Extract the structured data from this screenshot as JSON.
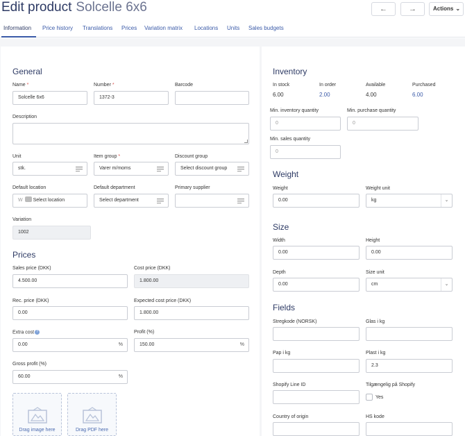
{
  "header": {
    "title": "Edit product",
    "product_name": "Solcelle 6x6",
    "prev_label": "←",
    "next_label": "→",
    "actions_label": "Actions"
  },
  "tabs": [
    {
      "label": "Information"
    },
    {
      "label": "Price history"
    },
    {
      "label": "Translations"
    },
    {
      "label": "Prices"
    },
    {
      "label": "Variation matrix"
    },
    {
      "label": "Locations"
    },
    {
      "label": "Units"
    },
    {
      "label": "Sales budgets"
    }
  ],
  "general": {
    "title": "General",
    "name": {
      "label": "Name",
      "required": "*",
      "value": "Solcelle 6x6"
    },
    "number": {
      "label": "Number",
      "required": "*",
      "value": "1372-3"
    },
    "barcode": {
      "label": "Barcode",
      "value": ""
    },
    "description": {
      "label": "Description",
      "value": ""
    },
    "unit": {
      "label": "Unit",
      "value": "stk."
    },
    "item_group": {
      "label": "Item group",
      "required": "*",
      "value": "Varer m/moms"
    },
    "discount_group": {
      "label": "Discount group",
      "value": "Select discount group"
    },
    "default_location": {
      "label": "Default location",
      "prefix": "W",
      "value": "Select location"
    },
    "default_department": {
      "label": "Default department",
      "value": "Select department"
    },
    "primary_supplier": {
      "label": "Primary supplier",
      "value": ""
    },
    "variation": {
      "label": "Variation",
      "value": "1002"
    }
  },
  "prices": {
    "title": "Prices",
    "sales_price": {
      "label": "Sales price (DKK)",
      "value": "4.500.00"
    },
    "cost_price": {
      "label": "Cost price (DKK)",
      "value": "1.800.00"
    },
    "rec_price": {
      "label": "Rec. price (DKK)",
      "value": "0.00"
    },
    "expected_cost": {
      "label": "Expected cost price (DKK)",
      "value": "1.800.00"
    },
    "extra_cost": {
      "label": "Extra cost",
      "value": "0.00",
      "suffix": "%"
    },
    "profit": {
      "label": "Profit (%)",
      "value": "150.00",
      "suffix": "%"
    },
    "gross_profit": {
      "label": "Gross profit (%)",
      "value": "60.00",
      "suffix": "%"
    },
    "drag_image": "Drag image here",
    "drag_pdf": "Drag PDF here"
  },
  "inventory": {
    "title": "Inventory",
    "in_stock": {
      "label": "In stock",
      "value": "6.00"
    },
    "in_order": {
      "label": "In order",
      "value": "2.00"
    },
    "available": {
      "label": "Available",
      "value": "4.00"
    },
    "purchased": {
      "label": "Purchased",
      "value": "6.00"
    },
    "min_inventory": {
      "label": "Min. inventory quantity",
      "placeholder": "0"
    },
    "min_purchase": {
      "label": "Min. purchase quantity",
      "placeholder": "0"
    },
    "min_sales": {
      "label": "Min. sales quantity",
      "placeholder": "0"
    }
  },
  "weight": {
    "title": "Weight",
    "weight": {
      "label": "Weight",
      "value": "0.00"
    },
    "weight_unit": {
      "label": "Weight unit",
      "value": "kg"
    }
  },
  "size": {
    "title": "Size",
    "width": {
      "label": "Width",
      "value": "0.00"
    },
    "height": {
      "label": "Height",
      "value": "0.00"
    },
    "depth": {
      "label": "Depth",
      "value": "0.00"
    },
    "size_unit": {
      "label": "Size unit",
      "value": "cm"
    }
  },
  "fields": {
    "title": "Fields",
    "stregkode": {
      "label": "Stregkode (NORSK)",
      "value": ""
    },
    "glas": {
      "label": "Glas i kg",
      "value": ""
    },
    "pap": {
      "label": "Pap i kg",
      "value": ""
    },
    "plast": {
      "label": "Plast i kg",
      "value": "2.3"
    },
    "shopify_line": {
      "label": "Shopify Line ID",
      "value": ""
    },
    "tilgaengelig": {
      "label": "Tilgængelig på Shopify",
      "checkbox_label": "Yes"
    },
    "country": {
      "label": "Country of origin",
      "value": ""
    },
    "hs_kode": {
      "label": "HS kode",
      "value": ""
    }
  },
  "colors": {
    "accent": "#3a5aa8",
    "title": "#2d3a64",
    "required": "#d9534f"
  }
}
